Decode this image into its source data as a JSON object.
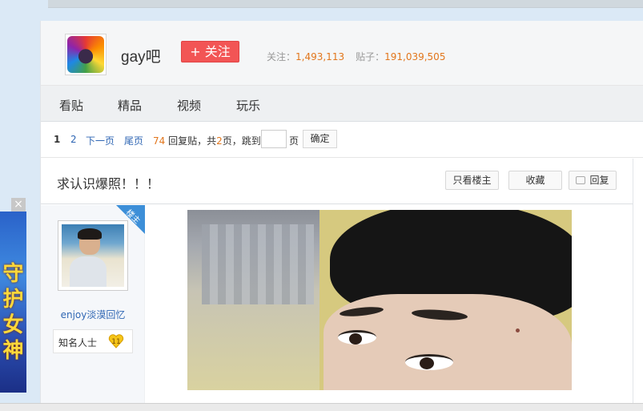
{
  "forum": {
    "name": "gay吧",
    "follow_label": "+ 关注",
    "follow_count_label": "关注：",
    "follow_count": "1,493,113",
    "post_count_label": "贴子：",
    "post_count": "191,039,505"
  },
  "nav": {
    "items": [
      "看贴",
      "精品",
      "视频",
      "玩乐"
    ]
  },
  "pager": {
    "current_page": "1",
    "page_2": "2",
    "next_page": "下一页",
    "last_page": "尾页",
    "reply_count": "74",
    "reply_text": "回复贴，共",
    "page_total": "2",
    "page_total_suffix": "页，跳到",
    "page_unit": "页",
    "jump_value": "",
    "confirm": "确定"
  },
  "thread": {
    "title": "求认识爆照！！！",
    "only_op_label": "只看楼主",
    "collect_label": "收藏",
    "reply_label": "回复"
  },
  "post": {
    "op_badge": "楼主",
    "username": "enjoy淡漠回忆",
    "level_title": "知名人士",
    "level": "11"
  },
  "ad": {
    "close": "×",
    "text": "守护女神"
  },
  "colors": {
    "follow_button": "#f25555",
    "stat_number": "#e2761c",
    "link": "#3067b4",
    "op_badge": "#3d8fd8",
    "level_badge": "#f5c518"
  }
}
